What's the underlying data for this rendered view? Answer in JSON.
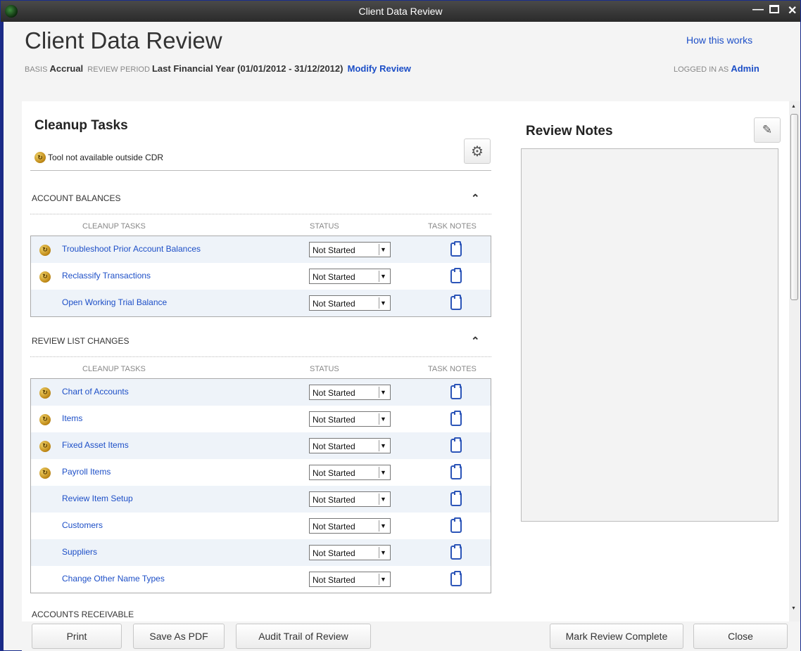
{
  "window": {
    "title": "Client Data Review"
  },
  "header": {
    "title": "Client Data Review",
    "how_link": "How this works",
    "basis_label": "BASIS",
    "basis_value": "Accrual",
    "period_label": "REVIEW PERIOD",
    "period_value": "Last Financial Year (01/01/2012 - 31/12/2012)",
    "modify_link": "Modify Review",
    "logged_label": "LOGGED IN AS",
    "logged_user": "Admin"
  },
  "cleanup": {
    "title": "Cleanup Tasks",
    "legend": "Tool not available outside CDR",
    "col_tasks": "CLEANUP TASKS",
    "col_status": "STATUS",
    "col_notes": "TASK NOTES",
    "groups": [
      {
        "title": "ACCOUNT BALANCES",
        "rows": [
          {
            "task": "Troubleshoot Prior Account Balances",
            "status": "Not Started",
            "cdr_only": true
          },
          {
            "task": "Reclassify Transactions",
            "status": "Not Started",
            "cdr_only": true
          },
          {
            "task": "Open Working Trial Balance",
            "status": "Not Started",
            "cdr_only": false
          }
        ]
      },
      {
        "title": "REVIEW LIST CHANGES",
        "rows": [
          {
            "task": "Chart of Accounts",
            "status": "Not Started",
            "cdr_only": true
          },
          {
            "task": "Items",
            "status": "Not Started",
            "cdr_only": true
          },
          {
            "task": "Fixed Asset Items",
            "status": "Not Started",
            "cdr_only": true
          },
          {
            "task": "Payroll Items",
            "status": "Not Started",
            "cdr_only": true
          },
          {
            "task": "Review Item Setup",
            "status": "Not Started",
            "cdr_only": false
          },
          {
            "task": "Customers",
            "status": "Not Started",
            "cdr_only": false
          },
          {
            "task": "Suppliers",
            "status": "Not Started",
            "cdr_only": false
          },
          {
            "task": "Change Other Name Types",
            "status": "Not Started",
            "cdr_only": false
          }
        ]
      }
    ],
    "partial_group": "ACCOUNTS RECEIVABLE"
  },
  "review_notes": {
    "title": "Review Notes"
  },
  "footer": {
    "print": "Print",
    "save_pdf": "Save As PDF",
    "audit": "Audit Trail of Review",
    "mark_complete": "Mark Review Complete",
    "close": "Close"
  }
}
